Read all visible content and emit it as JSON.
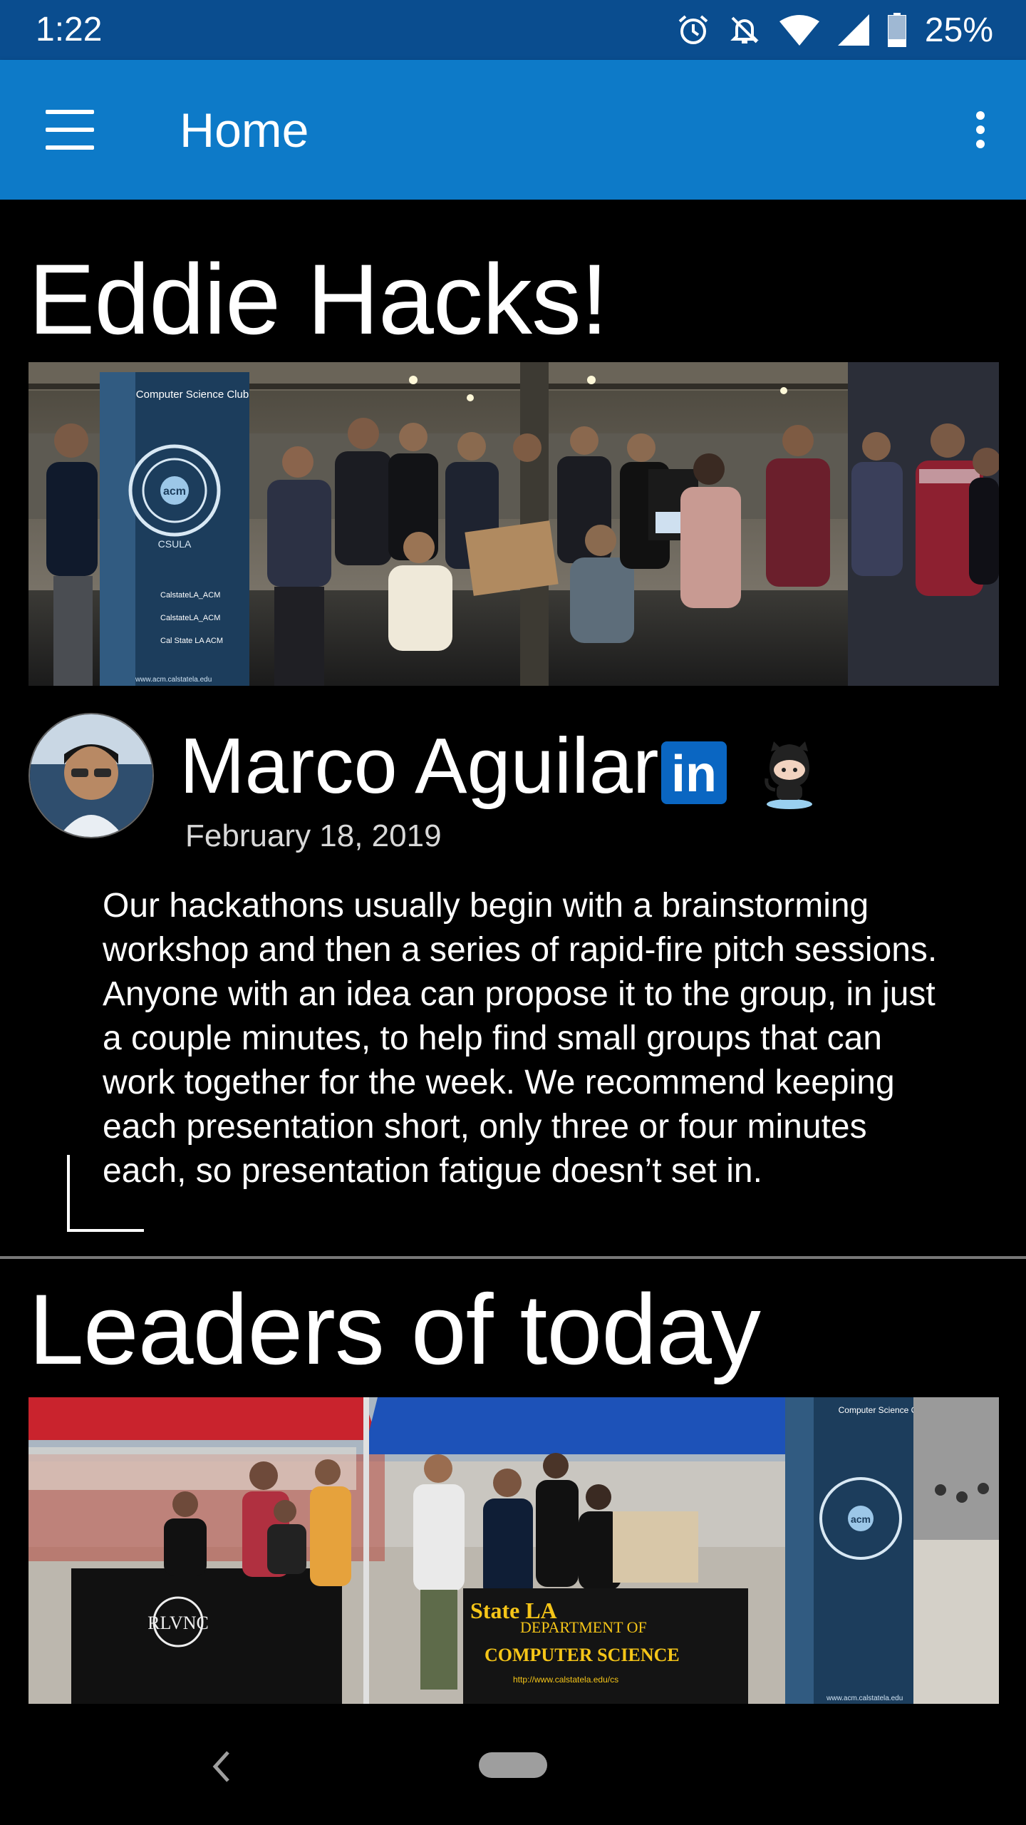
{
  "status_bar": {
    "time": "1:22",
    "battery": "25%",
    "icons": [
      "alarm-icon",
      "bell-off-icon",
      "wifi-icon",
      "signal-icon",
      "battery-icon"
    ]
  },
  "app_bar": {
    "title": "Home",
    "icons": [
      "menu-icon",
      "more-vert-icon"
    ],
    "color": "#0d7ac8"
  },
  "posts": [
    {
      "title": "Eddie Hacks!",
      "image_alt": "Group photo of club members",
      "author": {
        "name": "Marco Aguilar",
        "date": "February 18, 2019",
        "social_icons": [
          "linkedin-icon",
          "github-icon"
        ]
      },
      "body": "Our hackathons usually begin with a brainstorming workshop and then a series of rapid-fire pitch sessions. Anyone with an idea can propose it to the group, in just a couple minutes, to help find small groups that can work together for the week. We recommend keeping each presentation short, only three or four minutes each, so presentation fatigue doesn’t set in."
    },
    {
      "title": "Leaders of today",
      "image_alt": "Department of Computer Science booth"
    }
  ],
  "banner_text": {
    "club": "Computer Science Club",
    "org": "Association for Computing Machinery",
    "school": "CSULA",
    "logo": "acm",
    "social": [
      "CalstateLA_ACM",
      "CalstateLA_ACM",
      "Cal State LA ACM"
    ],
    "web": "www.acm.calstatela.edu",
    "department": "DEPARTMENT OF",
    "department_name": "COMPUTER SCIENCE",
    "department_url": "http://www.calstatela.edu/cs",
    "state_la": "State LA"
  },
  "nav_bar": {
    "icons": [
      "back-icon",
      "home-pill-icon"
    ]
  }
}
